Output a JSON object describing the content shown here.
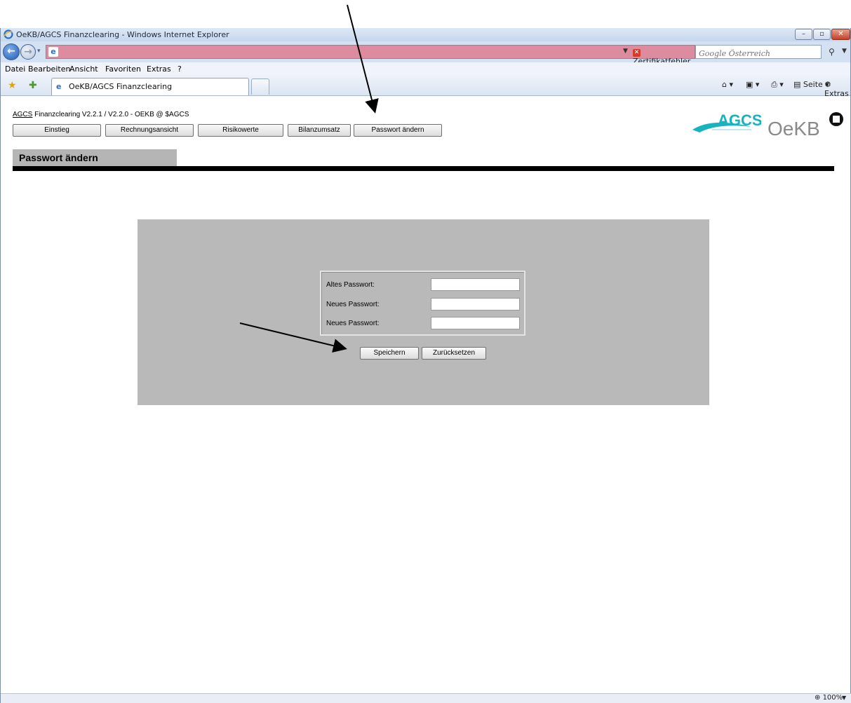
{
  "window": {
    "title": "OeKB/AGCS Finanzclearing - Windows Internet Explorer",
    "controls": {
      "minimize": "–",
      "maximize": "▫",
      "close": "✕"
    }
  },
  "address_bar": {
    "cert_error": "Zertifikatfehler",
    "search_placeholder": "Google Österreich"
  },
  "menu": [
    "Datei",
    "Bearbeiten",
    "Ansicht",
    "Favoriten",
    "Extras",
    "?"
  ],
  "tab": {
    "label": "OeKB/AGCS Finanzclearing"
  },
  "commands": {
    "page": "Seite",
    "tools": "Extras"
  },
  "app": {
    "version_link": "AGCS",
    "version_text": " Finanzclearing V2.2.1 / V2.2.0 - OEKB @ $AGCS",
    "nav": [
      "Einstieg",
      "Rechnungsansicht",
      "Risikowerte",
      "Bilanzumsatz",
      "Passwort ändern"
    ],
    "section_title": "Passwort ändern",
    "logos": {
      "agcs": "AGCS",
      "oekb": "OeKB"
    }
  },
  "form": {
    "fields": [
      {
        "label": "Altes Passwort:",
        "value": ""
      },
      {
        "label": "Neues Passwort:",
        "value": ""
      },
      {
        "label": "Neues Passwort:",
        "value": ""
      }
    ],
    "save_label": "Speichern",
    "reset_label": "Zurücksetzen"
  },
  "status_bar": {
    "zoom": "100%"
  },
  "colors": {
    "address_bar": "#dd8c9f",
    "form_panel": "#b9b9b9",
    "section_header": "#b5b5b5",
    "agcs_teal": "#19b3c0",
    "oekb_gray": "#8a8a8a"
  }
}
